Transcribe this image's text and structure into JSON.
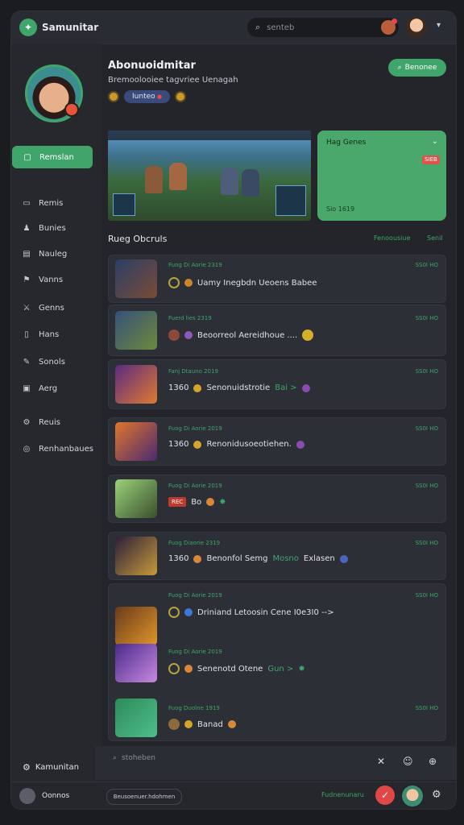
{
  "app": {
    "title": "Samunitar"
  },
  "topbar": {
    "search_placeholder": "senteb"
  },
  "profile": {
    "name": "Abonuoidmitar",
    "subtitle": "Bremoolooiee tagvriee Uenagah",
    "chip_label": "Iunteo"
  },
  "header_button": {
    "label": "Benonee"
  },
  "sidebar": {
    "active": {
      "label": "Remslan"
    },
    "items": [
      {
        "label": "Remis",
        "icon": "chat-icon"
      },
      {
        "label": "Bunies",
        "icon": "user-icon"
      },
      {
        "label": "Nauleg",
        "icon": "card-icon"
      },
      {
        "label": "Vanns",
        "icon": "flag-icon"
      },
      {
        "label": "Genns",
        "icon": "sword-icon"
      },
      {
        "label": "Hans",
        "icon": "book-icon"
      },
      {
        "label": "Sonols",
        "icon": "pen-icon"
      },
      {
        "label": "Aerg",
        "icon": "lock-icon"
      },
      {
        "label": "Reuis",
        "icon": "gear-icon"
      },
      {
        "label": "Renhanbaues",
        "icon": "globe-icon"
      }
    ],
    "bottom": {
      "label": "Kamunitan"
    }
  },
  "promo": {
    "title": "Hag Genes",
    "tag": "SIEB",
    "footer": "Sio 1619"
  },
  "section": {
    "title": "Rueg Obcruls",
    "link_a": "Fenoousiue",
    "link_b": "Senil"
  },
  "cards": [
    {
      "meta": "Fuog Di Aorie 2319",
      "right": "SS0I HO",
      "text": "Uamy Inegbdn Ueoens Babee"
    },
    {
      "meta": "Fuerd lies 2319",
      "right": "SS0I HO",
      "text": "Beoorreol Aereidhoue ...."
    },
    {
      "meta": "Fanj Dtauno 2019",
      "right": "SS0I HO",
      "num": "1360",
      "text": "Senonuidstrotie",
      "hl": "Bai >"
    },
    {
      "meta": "Fuog Di Aorie 2019",
      "right": "SS0I HO",
      "num": "1360",
      "text": "Renonidusoeotiehen."
    },
    {
      "meta": "Fuog Di Aorie 2019",
      "right": "SS0I HO",
      "rec": "REC",
      "text": "Bo"
    },
    {
      "meta": "Fuog Diaorie 2319",
      "right": "SS0I HO",
      "num": "1360",
      "text": "Benonfol Semg",
      "hl": "Mosno",
      "tail": "Exlasen"
    },
    {
      "meta": "Fuog Di Aorie 2019",
      "right": "SS0I HO",
      "text": "Driniand Letoosin Cene I0e3I0 -->"
    },
    {
      "meta": "Fuog Di Aorie 2019",
      "right": "",
      "text": "Senenotd Otene",
      "hl": "Gun >"
    },
    {
      "meta": "Fuog Duolne 1919",
      "right": "SS0I HO",
      "text": "Banad"
    }
  ],
  "chat": {
    "placeholder": "stoheben"
  },
  "bottom_bar": {
    "user": "Oonnos",
    "pill": "Beusoenuer.hdohmen",
    "green": "Fudnenunaru"
  }
}
